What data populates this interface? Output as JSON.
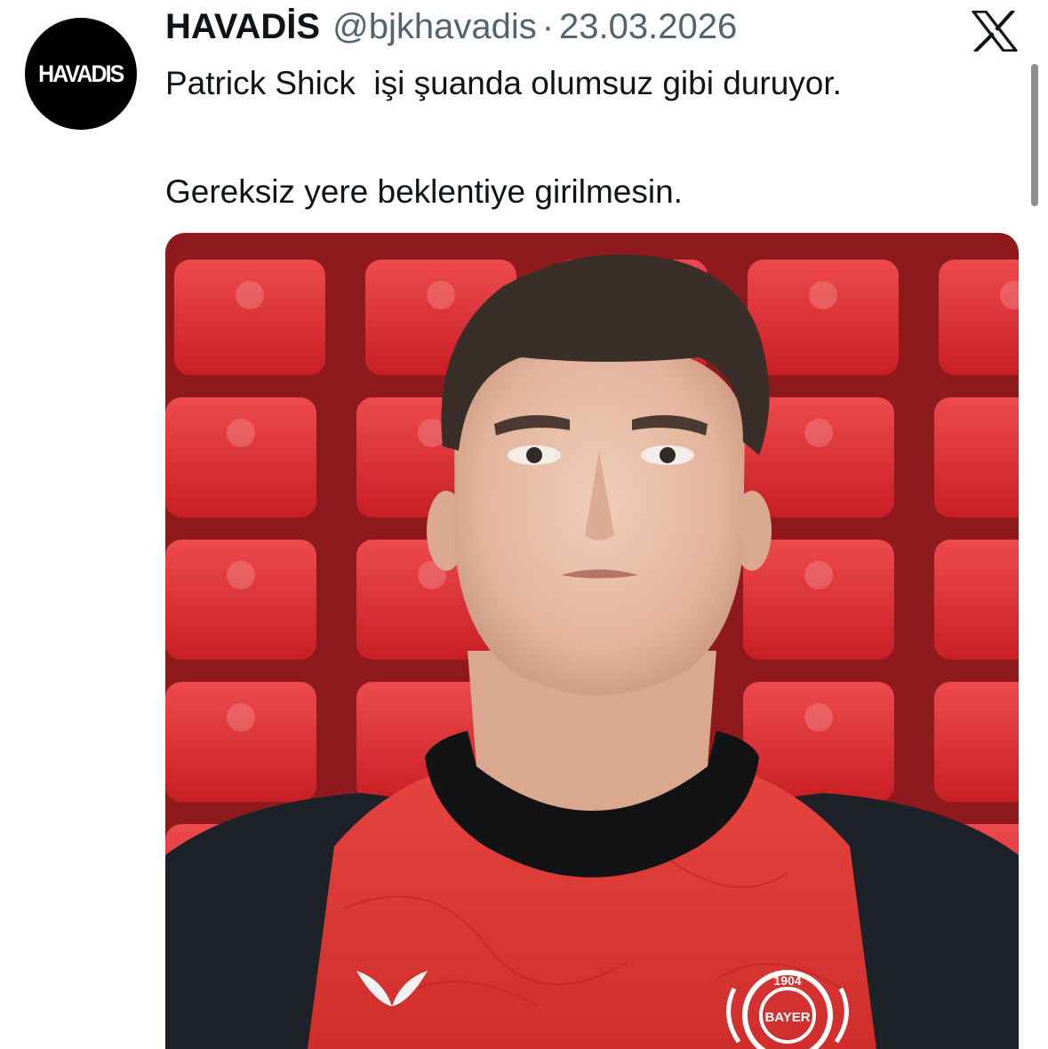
{
  "author": {
    "name": "HAVADİS",
    "handle": "@bjkhavadis",
    "separator": "·",
    "date": "23.03.2026",
    "avatar_logo_text": "HAVADIS"
  },
  "tweet": {
    "lines": [
      "Patrick Shick  işi şuanda olumsuz gibi duruyor.",
      "Gereksiz yere beklentiye girilmesin."
    ]
  },
  "media": {
    "crest_year": "1904",
    "crest_text": "BAYER",
    "colors": {
      "seats": "#e2272c",
      "shirt": "#e03a35",
      "sleeve": "#1d2228",
      "collar": "#111315",
      "skin": "#e8c2ad",
      "hair": "#3a2f28"
    }
  },
  "icons": {
    "platform": "x-logo-icon"
  }
}
